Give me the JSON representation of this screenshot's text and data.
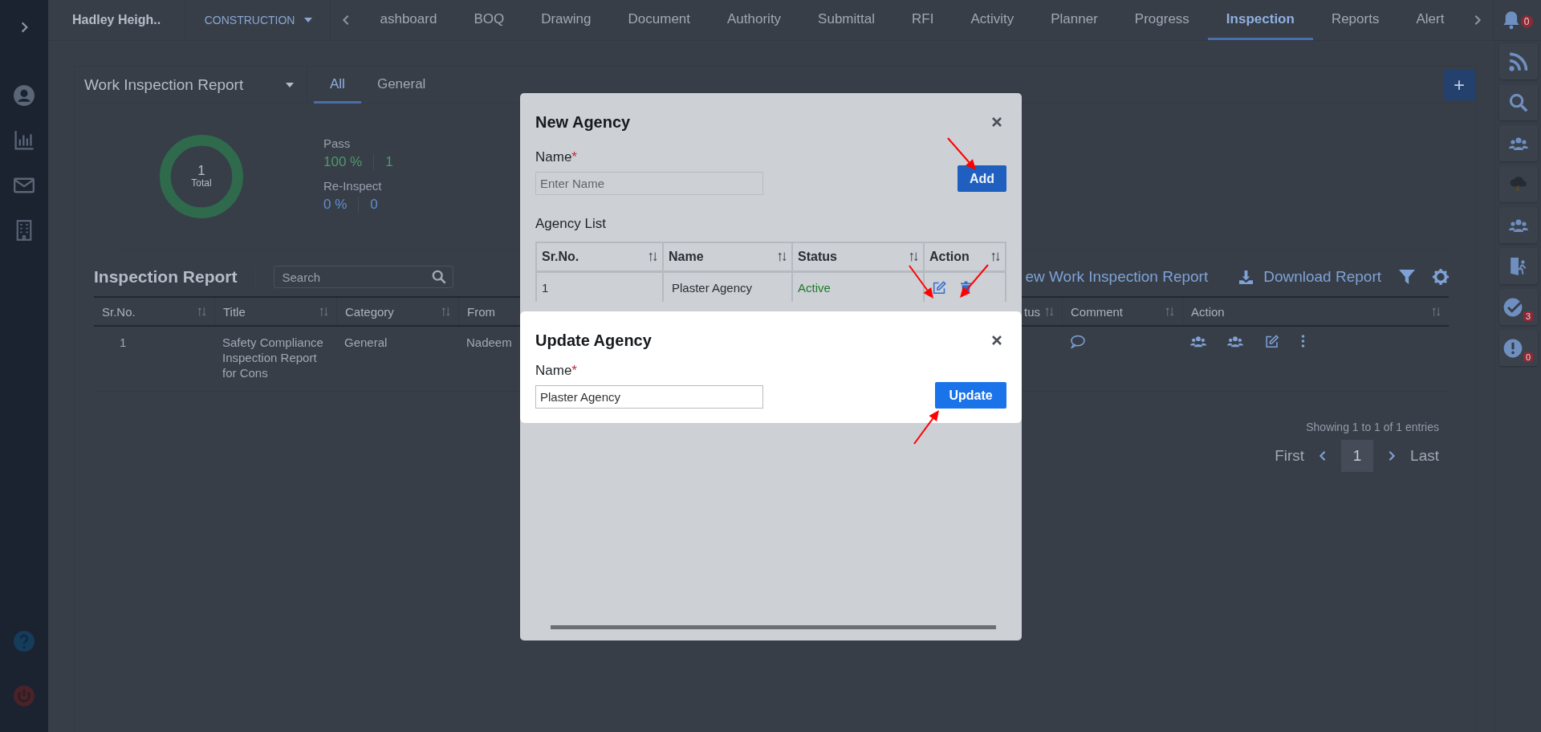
{
  "top_bar": {
    "project": "Hadley Heigh..",
    "module": "CONSTRUCTION",
    "tabs": [
      {
        "label": "ashboard",
        "selected": false
      },
      {
        "label": "BOQ",
        "selected": false
      },
      {
        "label": "Drawing",
        "selected": false
      },
      {
        "label": "Document",
        "selected": false
      },
      {
        "label": "Authority",
        "selected": false
      },
      {
        "label": "Submittal",
        "selected": false
      },
      {
        "label": "RFI",
        "selected": false
      },
      {
        "label": "Activity",
        "selected": false
      },
      {
        "label": "Planner",
        "selected": false
      },
      {
        "label": "Progress",
        "selected": false
      },
      {
        "label": "Inspection",
        "selected": true
      },
      {
        "label": "Reports",
        "selected": false
      },
      {
        "label": "Alert",
        "selected": false
      }
    ],
    "notification_count": "0"
  },
  "report_header": {
    "title": "Work Inspection Report",
    "tabs": [
      {
        "label": "All",
        "selected": true
      },
      {
        "label": "General",
        "selected": false
      }
    ],
    "add_button": "+"
  },
  "summary": {
    "total": "1",
    "total_label": "Total",
    "level": 1
  },
  "stats": [
    {
      "label": "Pass",
      "percent": "100 %",
      "count": "1",
      "color": "#4f9a6a"
    },
    {
      "label": "Re-Inspect",
      "percent": "0 %",
      "count": "0",
      "color": "#5f8fd0"
    }
  ],
  "report_section": {
    "title": "Inspection Report",
    "search_placeholder": "Search",
    "new_report_link": "ew Work Inspection Report",
    "download_link": "Download Report"
  },
  "table": {
    "columns": [
      "Sr.No.",
      "Title",
      "Category",
      "From",
      "tus",
      "Comment",
      "Action"
    ],
    "rows": [
      {
        "sr": "1",
        "title": "Safety Compliance Inspection Report for Cons",
        "category": "General",
        "from": "Nadeem"
      }
    ]
  },
  "pagination": {
    "summary": "Showing 1 to 1 of 1 entries",
    "first": "First",
    "pages": [
      {
        "label": "1",
        "selected": true
      }
    ],
    "last": "Last"
  },
  "right_rail": [
    {
      "kind": "feed"
    },
    {
      "kind": "search"
    },
    {
      "kind": "users"
    },
    {
      "kind": "weather"
    },
    {
      "kind": "team"
    },
    {
      "kind": "exit"
    },
    {
      "kind": "check",
      "badge": "3"
    },
    {
      "kind": "alert",
      "badge": "0"
    }
  ],
  "new_agency_modal": {
    "title": "New Agency",
    "name_label": "Name",
    "required_mark": "*",
    "name_placeholder": "Enter Name",
    "add_button": "Add",
    "list_title": "Agency List",
    "columns": [
      "Sr.No.",
      "Name",
      "Status",
      "Action"
    ],
    "rows": [
      {
        "sr": "1",
        "name": "Plaster Agency",
        "status": "Active"
      }
    ]
  },
  "update_agency_modal": {
    "title": "Update Agency",
    "name_label": "Name",
    "required_mark": "*",
    "name_value": "Plaster Agency",
    "update_button": "Update"
  }
}
